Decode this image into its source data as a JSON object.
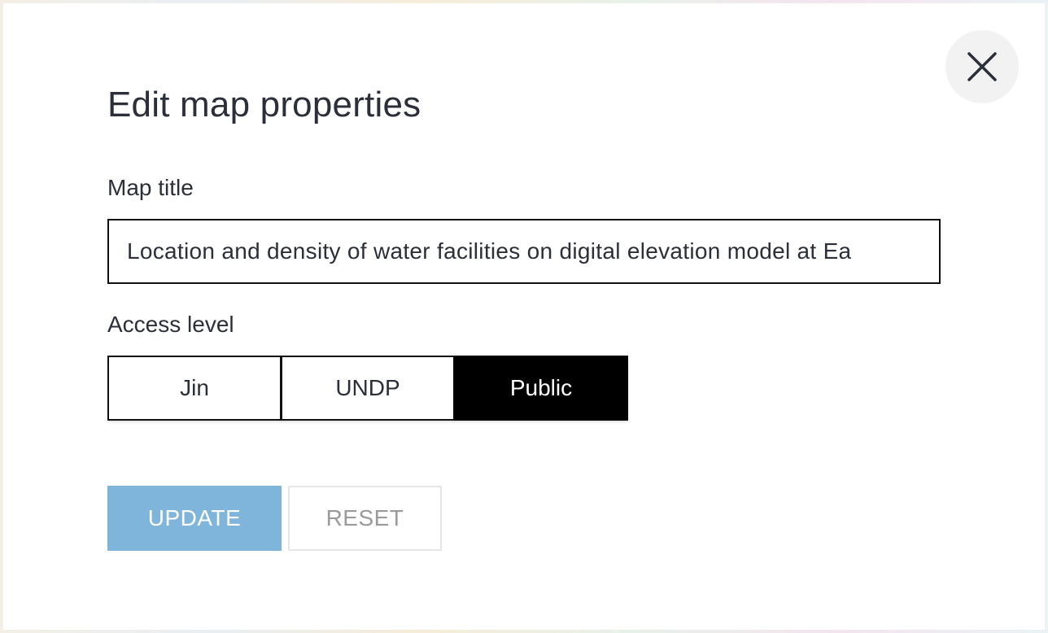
{
  "dialog": {
    "title": "Edit map properties",
    "map_title_label": "Map title",
    "map_title_value": "Location and density of water facilities on digital elevation model at Ea",
    "access_label": "Access level",
    "access_options": [
      {
        "label": "Jin",
        "selected": false
      },
      {
        "label": "UNDP",
        "selected": false
      },
      {
        "label": "Public",
        "selected": true
      }
    ],
    "update_label": "UPDATE",
    "reset_label": "RESET",
    "close_icon": "close-icon"
  },
  "colors": {
    "update_button": "#7fb5da",
    "selected_option": "#000000",
    "text": "#2a2f3a"
  }
}
